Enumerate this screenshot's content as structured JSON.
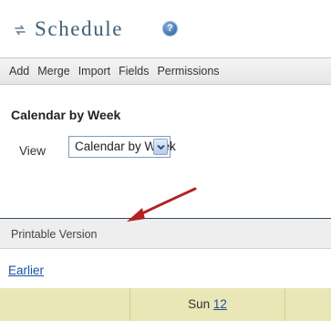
{
  "header": {
    "title": "Schedule",
    "help_icon": "help-icon",
    "help_glyph": "?"
  },
  "toolbar": {
    "items": [
      "Add",
      "Merge",
      "Import",
      "Fields",
      "Permissions"
    ]
  },
  "view": {
    "heading": "Calendar by Week",
    "label": "View",
    "selected": "Calendar by Week"
  },
  "printable": {
    "label": "Printable Version"
  },
  "navigation": {
    "earlier": "Earlier"
  },
  "calendar": {
    "days": [
      {
        "name": "Sun",
        "date": "12"
      }
    ]
  },
  "colors": {
    "title": "#3f5f76",
    "link": "#1a4fa0",
    "calendar_header": "#e9e7b5",
    "annotation_arrow": "#b22222"
  }
}
